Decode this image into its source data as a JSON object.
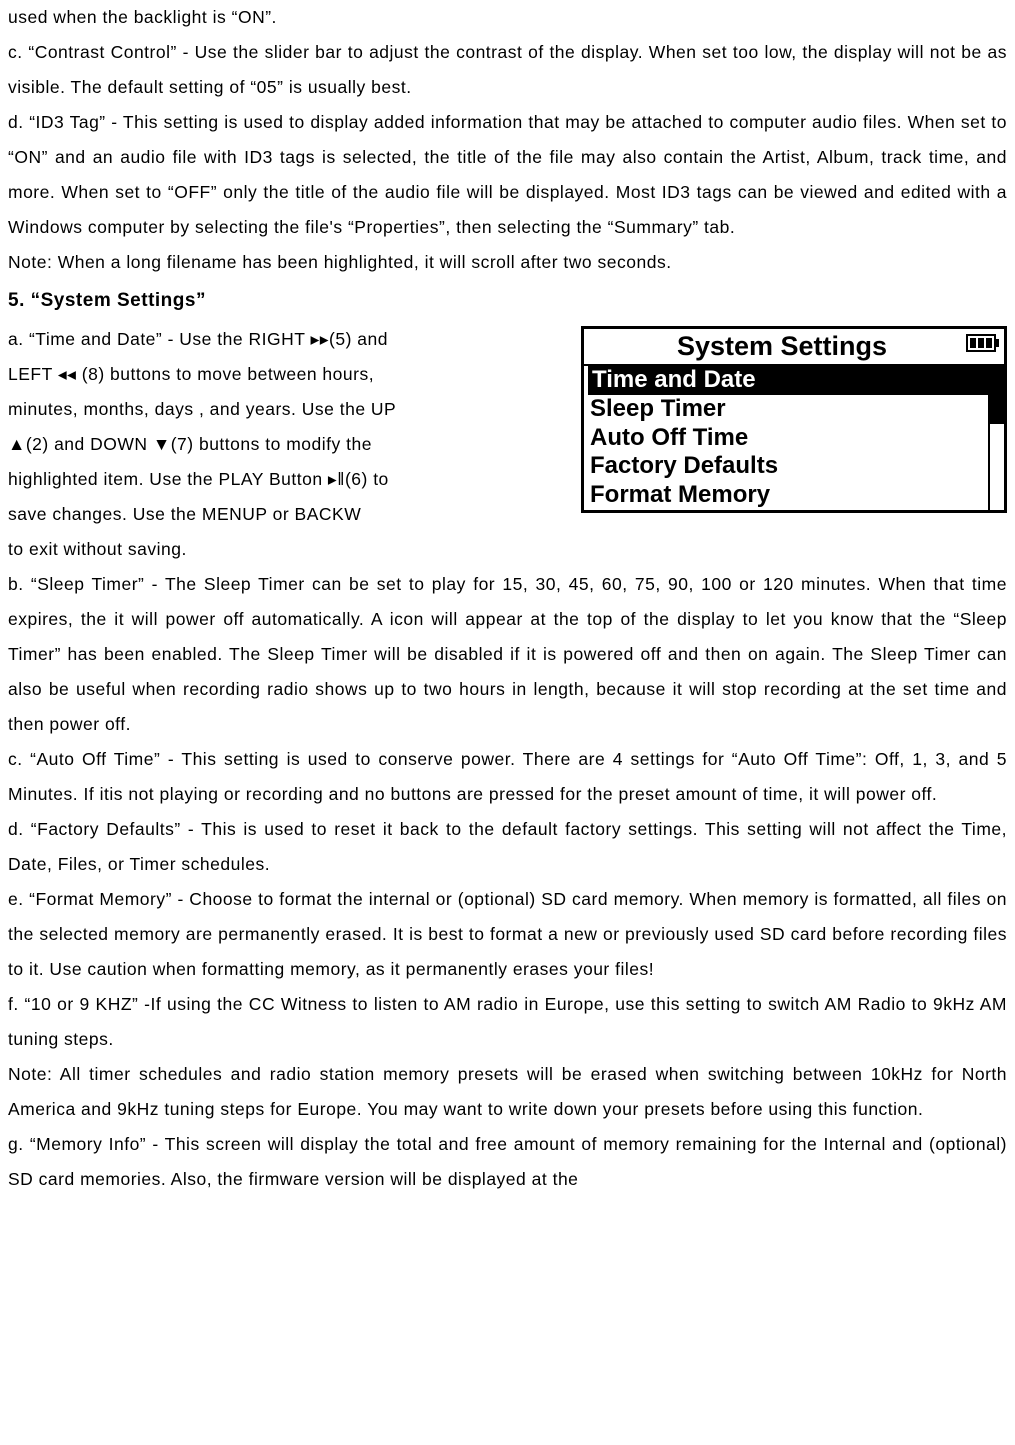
{
  "intro": {
    "p1": "used when the backlight is “ON”.",
    "p2": "c. “Contrast Control” - Use the slider bar to adjust the contrast of the display. When set too low, the display will not be as visible. The default setting of “05” is usually best.",
    "p3": "d. “ID3 Tag” - This setting is used to display added information that may be attached to computer audio files. When set to “ON” and an audio file with ID3 tags is selected, the title of the file may also contain the Artist, Album, track time, and more. When set to “OFF” only the title of the audio file will be displayed. Most ID3 tags can be viewed and edited with a Windows computer by selecting the file's “Properties”, then selecting the “Summary” tab.",
    "p4": "Note: When a long filename has been highlighted, it will scroll after two seconds."
  },
  "heading5": "5. “System Settings”",
  "screen": {
    "title": "System Settings",
    "items": [
      "Time and Date",
      "Sleep Timer",
      "Auto Off Time",
      "Factory Defaults",
      "Format Memory"
    ],
    "selected_index": 0
  },
  "sys": {
    "a1": "a. “Time and Date” - Use the RIGHT ▸▸(5) and",
    "a2": "LEFT ◂◂ (8) buttons to move between hours,",
    "a3": "minutes, months, days , and years. Use the UP",
    "a4": "▲(2) and DOWN ▼(7) buttons to modify the",
    "a5": "highlighted item. Use the PLAY Button ▸‖(6) to",
    "a6": "save changes. Use the MENUP or BACKW",
    "a7": "to exit without saving.",
    "b": "b. “Sleep Timer” - The Sleep Timer can be set to play for 15, 30, 45, 60, 75, 90, 100 or 120 minutes. When that time expires, the it will power off automatically. A icon will appear at the top of the display to let you know that the “Sleep Timer” has been enabled. The Sleep Timer will be disabled if it is powered off and then on again. The Sleep Timer can also be useful when recording radio shows up to two hours in length, because it will stop recording at the set time and then power off.",
    "c": "c. “Auto Off Time” - This setting is used to conserve power. There are 4 settings for “Auto Off Time”: Off, 1, 3, and 5 Minutes. If itis not playing or recording and no buttons are pressed for the preset amount of time, it will power off.",
    "d": "d. “Factory Defaults” - This is used to reset it back to the default factory settings. This setting will not affect the Time, Date, Files, or Timer schedules.",
    "e": "e. “Format Memory” - Choose to format the internal or (optional) SD card memory. When memory is formatted, all files on the selected memory are permanently erased. It is best to format a new or previously used SD card before recording files to it. Use caution when formatting memory, as it permanently erases your files!",
    "f": "f. “10 or 9 KHZ” -If using the CC Witness to listen to AM radio in Europe, use this setting to switch AM Radio to 9kHz AM tuning steps.",
    "note2": "Note: All timer schedules and radio station memory presets will be erased when switching between 10kHz for North America and 9kHz tuning steps for Europe. You may want to write down your presets before using this function.",
    "g": "g. “Memory Info” - This screen will display the total and free amount of memory remaining for the Internal and (optional) SD card memories. Also, the firmware version will be displayed at the"
  }
}
